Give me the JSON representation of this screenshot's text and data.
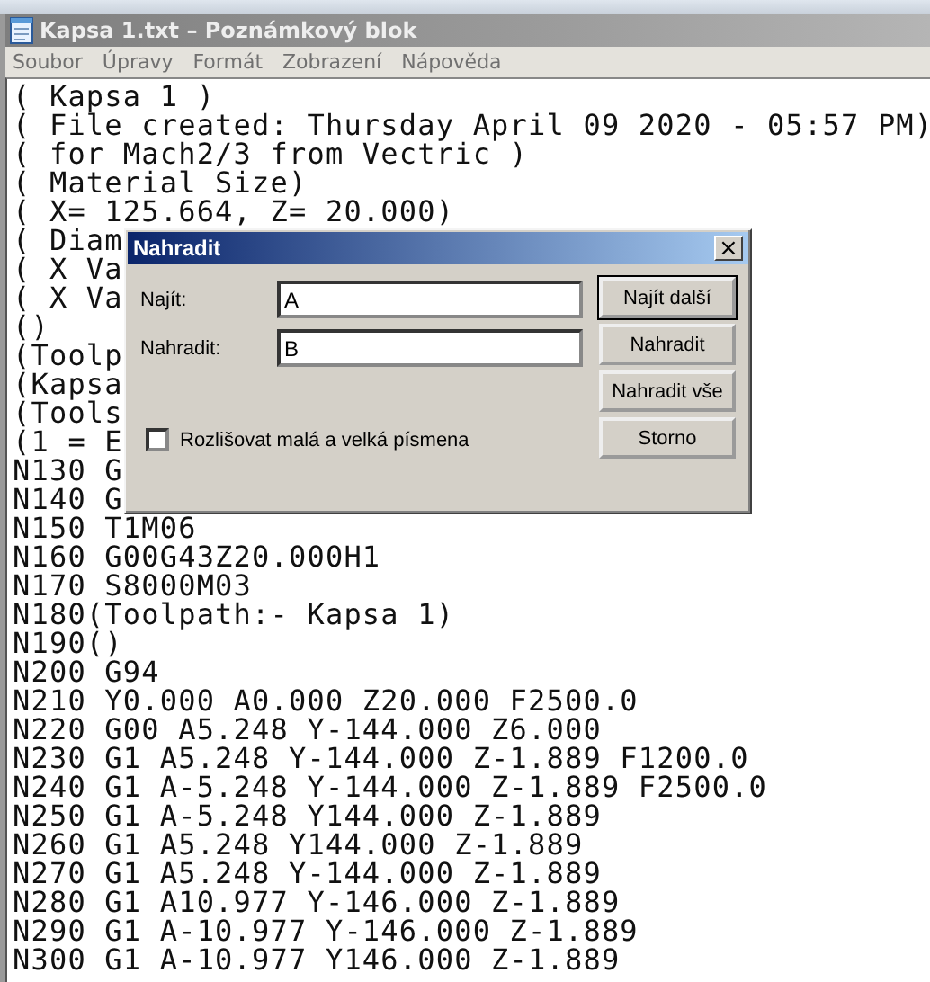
{
  "window": {
    "title": "Kapsa 1.txt – Poznámkový blok"
  },
  "menu": [
    "Soubor",
    "Úpravy",
    "Formát",
    "Zobrazení",
    "Nápověda"
  ],
  "lines": [
    "( Kapsa 1 )",
    "( File created: Thursday April 09 2020 - 05:57 PM)",
    "( for Mach2/3 from Vectric )",
    "( Material Size)",
    "( X= 125.664, Z= 20.000)",
    "( Diam",
    "( X Va",
    "( X Va",
    "()",
    "(Toolp",
    "(Kapsa",
    "(Tools",
    "(1 = E",
    "N130 G",
    "N140 G",
    "N150 T1M06",
    "N160 G00G43Z20.000H1",
    "N170 S8000M03",
    "N180(Toolpath:- Kapsa 1)",
    "N190()",
    "N200 G94",
    "N210 Y0.000 A0.000 Z20.000 F2500.0",
    "N220 G00 A5.248 Y-144.000 Z6.000",
    "N230 G1 A5.248 Y-144.000 Z-1.889 F1200.0",
    "N240 G1 A-5.248 Y-144.000 Z-1.889 F2500.0",
    "N250 G1 A-5.248 Y144.000 Z-1.889",
    "N260 G1 A5.248 Y144.000 Z-1.889",
    "N270 G1 A5.248 Y-144.000 Z-1.889",
    "N280 G1 A10.977 Y-146.000 Z-1.889",
    "N290 G1 A-10.977 Y-146.000 Z-1.889",
    "N300 G1 A-10.977 Y146.000 Z-1.889"
  ],
  "dialog": {
    "title": "Nahradit",
    "close": "×",
    "fields": [
      {
        "label": "Najít:",
        "value": "A"
      },
      {
        "label": "Nahradit:",
        "value": "B"
      }
    ],
    "checkbox": {
      "label": "Rozlišovat malá a velká písmena",
      "checked": false
    },
    "buttons": [
      {
        "label": "Najít další",
        "default": true
      },
      {
        "label": "Nahradit",
        "default": false
      },
      {
        "label": "Nahradit vše",
        "default": false
      },
      {
        "label": "Storno",
        "default": false
      }
    ]
  }
}
